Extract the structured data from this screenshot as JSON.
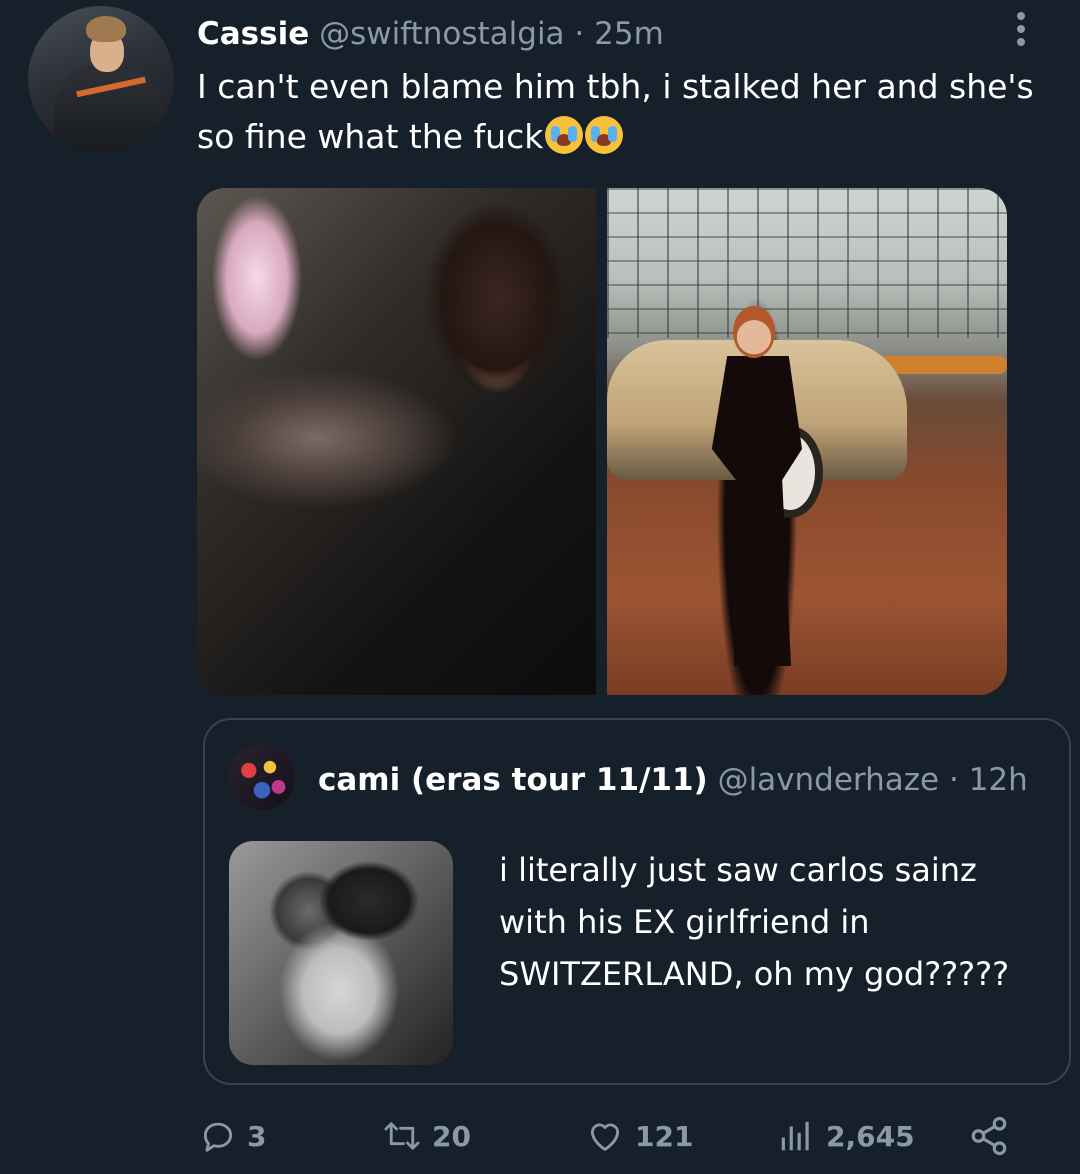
{
  "tweet": {
    "author_name": "Cassie",
    "author_handle": "@swiftnostalgia",
    "separator": "·",
    "time": "25m",
    "text": "I can't even blame him tbh, i stalked her and she's so fine what the fuck",
    "emoji": [
      "loudly-crying-face",
      "loudly-crying-face"
    ]
  },
  "quoted_tweet": {
    "author_name": "cami (eras tour 11/11)",
    "author_handle": "@lavnderhaze",
    "separator": "·",
    "time": "12h",
    "text": "i literally just saw carlos sainz with his EX girlfriend in SWITZERLAND, oh my god?????"
  },
  "actions": {
    "replies": "3",
    "retweets": "20",
    "likes": "121",
    "views": "2,645"
  },
  "colors": {
    "background": "#15202b",
    "secondary_text": "#8b98a5",
    "border": "#38444d"
  }
}
